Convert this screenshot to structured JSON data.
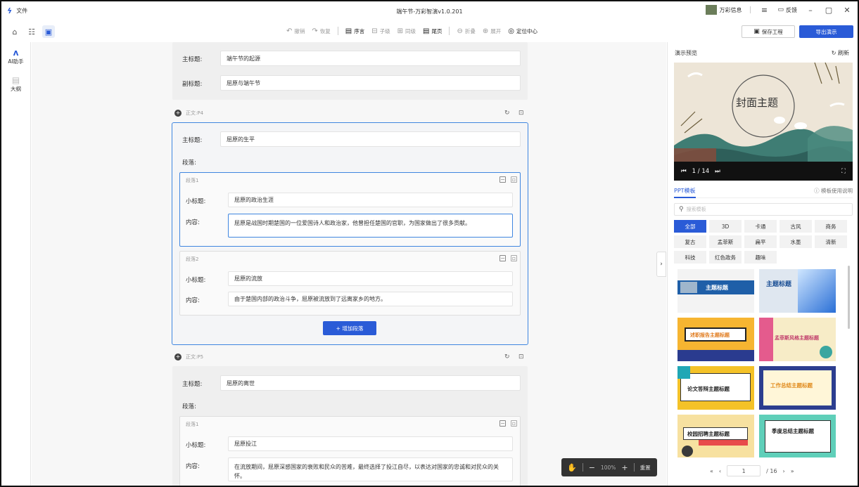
{
  "titlebar": {
    "file_menu": "文件",
    "title": "端午节-万彩智演v1.0.201",
    "account": "万彩信息",
    "menu_icon": "≡",
    "feedback": "反馈"
  },
  "toolbar": {
    "undo": "撤销",
    "redo": "恢复",
    "preface": "序言",
    "child": "子级",
    "sibling": "同级",
    "tail": "尾页",
    "fold": "折叠",
    "expand": "展开",
    "locate": "定位中心",
    "save": "保存工程",
    "export": "导出演示"
  },
  "rail": {
    "ai": "AI助手",
    "outline": "大纲"
  },
  "cover": {
    "main_label": "主标题:",
    "main_value": "端午节的起源",
    "sub_label": "副标题:",
    "sub_value": "屈原与端午节"
  },
  "p4": {
    "header": "正文:P4",
    "main_label": "主标题:",
    "main_value": "屈原的生平",
    "para_label": "段落:",
    "seg1": {
      "header": "段落1",
      "title_label": "小标题:",
      "title_value": "屈原的政治生涯",
      "content_label": "内容:",
      "content_value": "屈原是战国时期楚国的一位爱国诗人和政治家，他曾担任楚国的官职，为国家做出了很多贡献。"
    },
    "seg2": {
      "header": "段落2",
      "title_label": "小标题:",
      "title_value": "屈原的流放",
      "content_label": "内容:",
      "content_value": "由于楚国内部的政治斗争，屈原被流放到了远离家乡的地方。"
    },
    "add_button": "+ 增加段落"
  },
  "p5": {
    "header": "正文:P5",
    "main_label": "主标题:",
    "main_value": "屈原的离世",
    "para_label": "段落:",
    "seg1": {
      "header": "段落1",
      "title_label": "小标题:",
      "title_value": "屈原投江",
      "content_label": "内容:",
      "content_value": "在流放期间，屈原深感国家的衰败和民众的苦难，最终选择了投江自尽，以表达对国家的忠诚和对民众的关怀。"
    }
  },
  "zoom": {
    "value": "100%",
    "reset": "重置"
  },
  "right": {
    "title": "演示预览",
    "refresh": "刷新",
    "preview_title": "封面主题",
    "slide_counter": "1 / 14",
    "tab": "PPT模板",
    "help": "模板使用说明",
    "search_placeholder": "搜索模板",
    "categories": [
      "全部",
      "3D",
      "卡通",
      "古风",
      "商务",
      "复古",
      "孟菲斯",
      "扁平",
      "水墨",
      "清新",
      "科技",
      "红色政务",
      "趣味"
    ],
    "thumbs": [
      "主题标题",
      "主题标题",
      "述职报告主题标题",
      "孟菲斯风格主题标题",
      "论文答辩主题标题",
      "工作总结主题标题",
      "校园招聘主题标题",
      "季度总结主题标题"
    ],
    "page_current": "1",
    "page_total": "/ 16"
  },
  "colors": {
    "accent": "#2a5bd7",
    "select_border": "#3f86e0"
  }
}
